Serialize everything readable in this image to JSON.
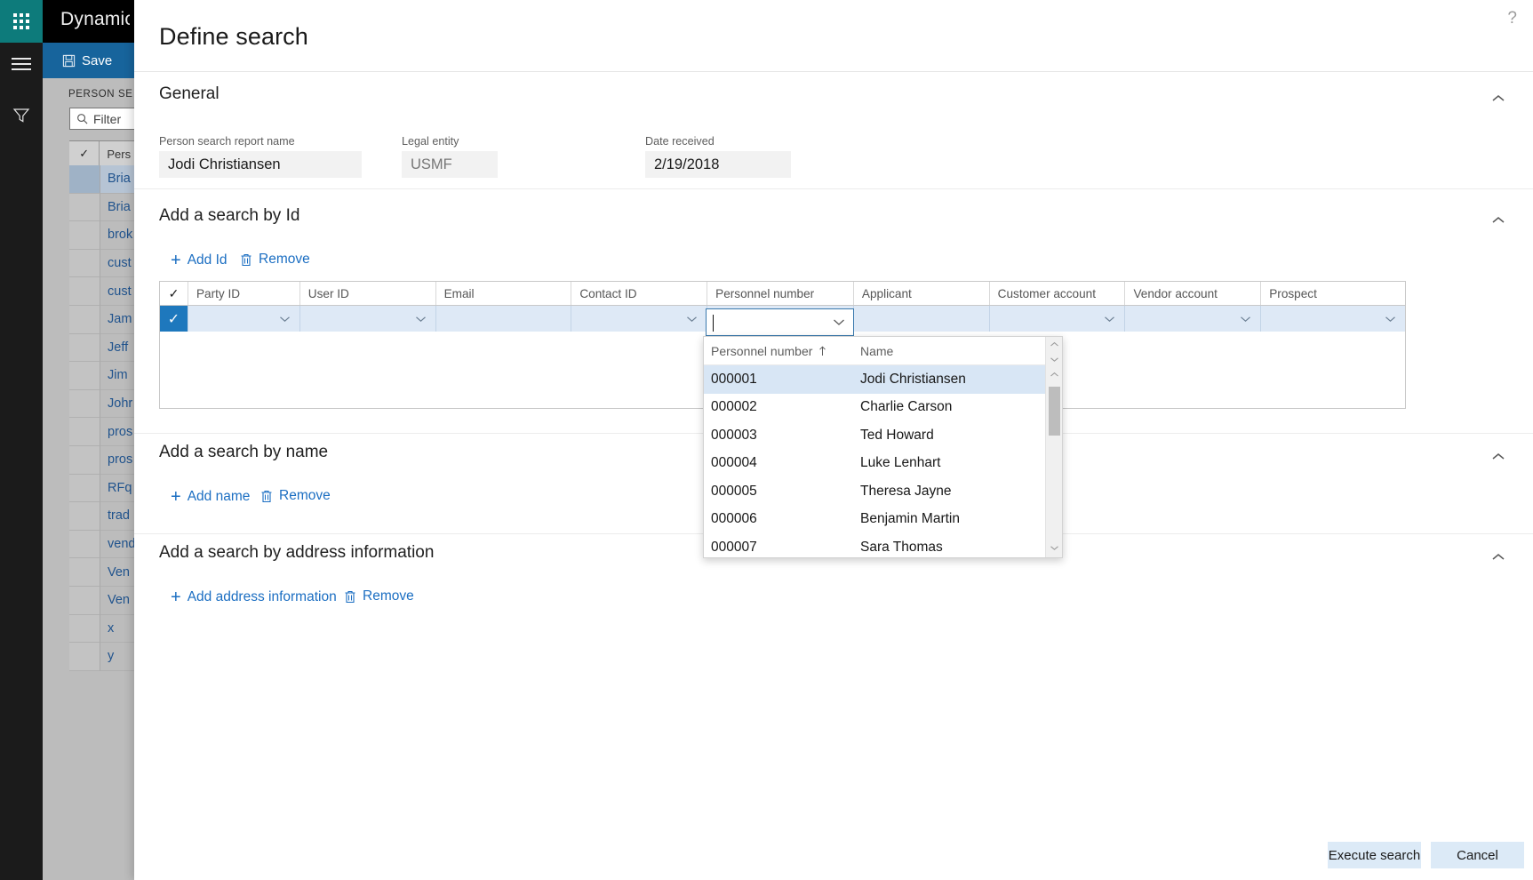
{
  "app": {
    "brand": "Dynamics",
    "waffle_icon": "app-launcher-icon",
    "hamburger_icon": "hamburger-menu-icon",
    "filter_rail_icon": "funnel-filter-icon",
    "command_bar": {
      "save_label": "Save",
      "save_icon": "save-disk-icon",
      "new_icon": "plus-icon"
    },
    "list_pane": {
      "caption": "PERSON SE",
      "filter_placeholder": "Filter",
      "search_icon": "magnifier-icon",
      "header_check_icon": "checkmark-icon",
      "header_label": "Pers",
      "rows": [
        "Bria",
        "Bria",
        "brok",
        "cust",
        "cust",
        "Jam",
        "Jeff",
        "Jim",
        "Johr",
        "pros",
        "pros",
        "RFq",
        "trad",
        "vend",
        "Ven",
        "Ven",
        "x",
        "y"
      ]
    }
  },
  "dialog": {
    "help_icon": "question-mark-icon",
    "title": "Define search",
    "collapse_icon": "chevron-up-icon",
    "sections": {
      "general": {
        "title": "General",
        "fields": [
          {
            "label": "Person search report name",
            "value": "Jodi Christiansen"
          },
          {
            "label": "Legal entity",
            "value": "USMF"
          },
          {
            "label": "Date received",
            "value": "2/19/2018"
          }
        ]
      },
      "by_id": {
        "title": "Add a search by Id",
        "add_label": "Add Id",
        "remove_label": "Remove",
        "add_icon": "plus-icon",
        "remove_icon": "trash-icon",
        "grid": {
          "header_check_icon": "checkmark-icon",
          "columns": [
            "Party ID",
            "User ID",
            "Email",
            "Contact ID",
            "Personnel number",
            "Applicant",
            "Customer account",
            "Vendor account",
            "Prospect"
          ],
          "row": {
            "selected": true,
            "row_check_icon": "checkmark-icon",
            "cells": [
              "",
              "",
              "",
              "",
              "",
              "",
              "",
              "",
              ""
            ],
            "dropdown_icon": "chevron-down-icon",
            "focused_column": "Personnel number",
            "focused_value": ""
          },
          "scrollbar": {
            "up_icon": "chevron-up-icon",
            "down_icon": "chevron-down-icon"
          }
        }
      },
      "by_name": {
        "title": "Add a search by name",
        "add_label": "Add name",
        "remove_label": "Remove",
        "add_icon": "plus-icon",
        "remove_icon": "trash-icon"
      },
      "by_address": {
        "title": "Add a search by address information",
        "add_label": "Add address information",
        "remove_label": "Remove",
        "add_icon": "plus-icon",
        "remove_icon": "trash-icon"
      }
    },
    "lookup": {
      "sort_icon": "sort-ascending-arrow",
      "columns": [
        "Personnel number",
        "Name"
      ],
      "rows": [
        {
          "number": "000001",
          "name": "Jodi Christiansen",
          "selected": true
        },
        {
          "number": "000002",
          "name": "Charlie Carson",
          "selected": false
        },
        {
          "number": "000003",
          "name": "Ted Howard",
          "selected": false
        },
        {
          "number": "000004",
          "name": "Luke Lenhart",
          "selected": false
        },
        {
          "number": "000005",
          "name": "Theresa Jayne",
          "selected": false
        },
        {
          "number": "000006",
          "name": "Benjamin Martin",
          "selected": false
        },
        {
          "number": "000007",
          "name": "Sara Thomas",
          "selected": false
        }
      ],
      "scrollbar": {
        "up_icon": "chevron-up-icon",
        "down_icon": "chevron-down-icon"
      }
    },
    "footer": {
      "primary_label": "Execute search",
      "secondary_label": "Cancel"
    }
  },
  "colors": {
    "teal": "#0d7b7b",
    "command_blue": "#17649c",
    "link_blue": "#1b6ec2",
    "row_selected": "#dee9f6",
    "check_blue": "#1e78bd",
    "button_blue": "#dceaf7"
  }
}
